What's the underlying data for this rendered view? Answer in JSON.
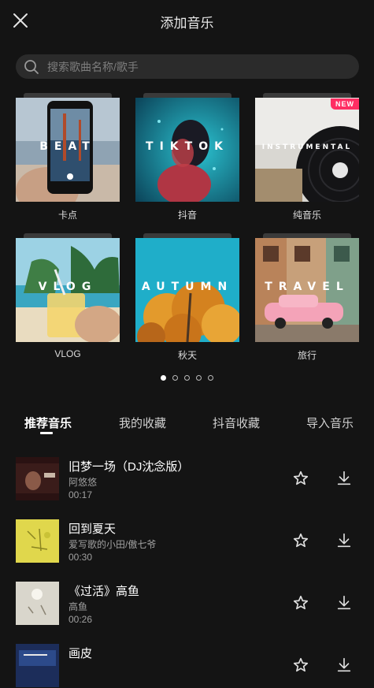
{
  "header": {
    "title": "添加音乐",
    "close_icon": "close-icon"
  },
  "search": {
    "placeholder": "搜索歌曲名称/歌手",
    "value": ""
  },
  "categories": [
    {
      "label": "卡点",
      "overlay": "BEAT",
      "new": false
    },
    {
      "label": "抖音",
      "overlay": "TIKTOK",
      "new": false
    },
    {
      "label": "纯音乐",
      "overlay": "INSTRUMENTAL",
      "new": true,
      "badge": "NEW"
    },
    {
      "label": "VLOG",
      "overlay": "VLOG",
      "new": false
    },
    {
      "label": "秋天",
      "overlay": "AUTUMN",
      "new": false
    },
    {
      "label": "旅行",
      "overlay": "TRAVEL",
      "new": false
    }
  ],
  "pagination": {
    "total": 5,
    "current": 1
  },
  "tabs": [
    "推荐音乐",
    "我的收藏",
    "抖音收藏",
    "导入音乐"
  ],
  "active_tab": 0,
  "songs": [
    {
      "title": "旧梦一场（DJ沈念版）",
      "artist": "阿悠悠",
      "duration": "00:17"
    },
    {
      "title": "回到夏天",
      "artist": "爱写歌的小田/傲七爷",
      "duration": "00:30"
    },
    {
      "title": "《过活》高鱼",
      "artist": "高鱼",
      "duration": "00:26"
    },
    {
      "title": "画皮",
      "artist": "",
      "duration": ""
    }
  ],
  "icons": {
    "star": "star-icon",
    "download": "download-icon",
    "search": "search-icon"
  },
  "colors": {
    "background": "#141414",
    "badge": "#ff2e63",
    "search_bg": "#2b2b2b"
  }
}
